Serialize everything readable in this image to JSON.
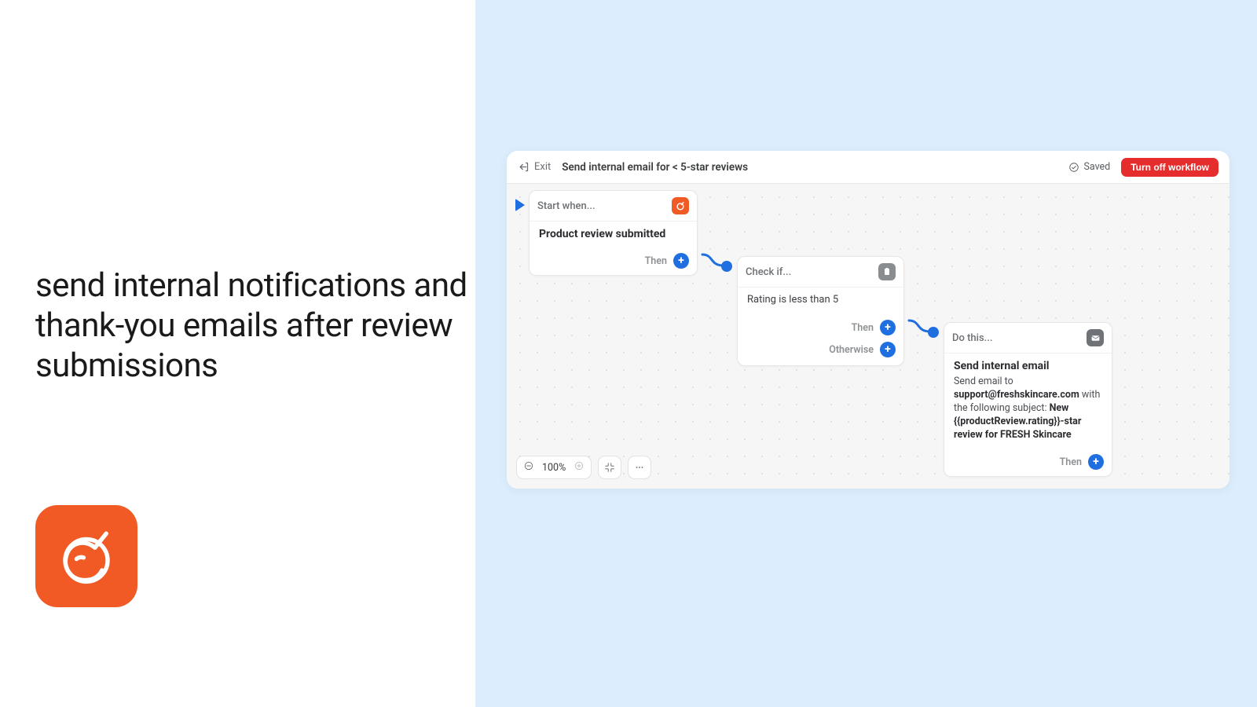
{
  "left": {
    "headline": "send internal notifications and thank-you emails after review submissions"
  },
  "topbar": {
    "exit": "Exit",
    "title": "Send internal email for < 5-star reviews",
    "saved": "Saved",
    "turn_off": "Turn off workflow"
  },
  "zoom": {
    "level": "100%"
  },
  "node1": {
    "header": "Start when...",
    "body": "Product review submitted",
    "then": "Then"
  },
  "node2": {
    "header": "Check if...",
    "body": "Rating is less than 5",
    "then": "Then",
    "otherwise": "Otherwise"
  },
  "node3": {
    "header": "Do this...",
    "title": "Send internal email",
    "desc_prefix": "Send email to ",
    "email": "support@freshskincare.com",
    "desc_mid": " with the following subject: ",
    "subject": "New {{productReview.rating}}-star review for FRESH Skincare",
    "then": "Then"
  }
}
